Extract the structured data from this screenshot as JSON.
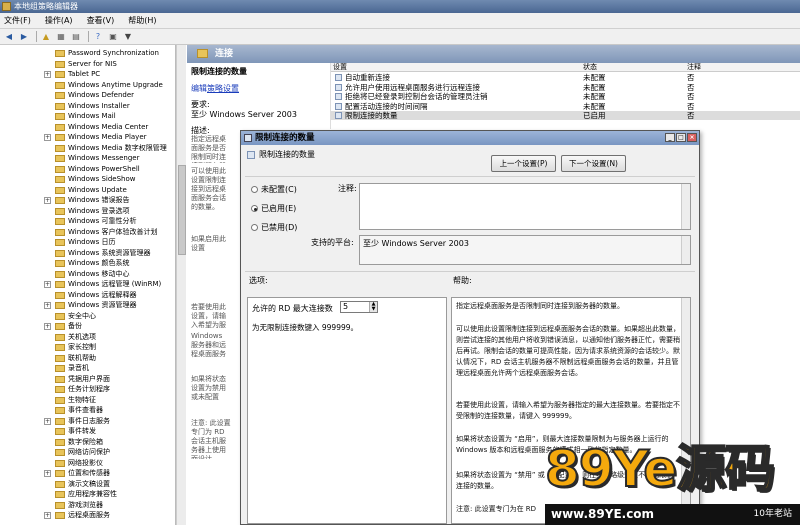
{
  "window": {
    "title": "本地组策略编辑器",
    "icon": "policy-editor-icon"
  },
  "menu": [
    "文件(F)",
    "操作(A)",
    "查看(V)",
    "帮助(H)"
  ],
  "toolbar": {
    "icons": [
      "back-icon",
      "forward-icon",
      "up-icon",
      "show-hide-tree-icon",
      "export-icon",
      "help-icon",
      "properties-icon",
      "filter-icon"
    ]
  },
  "tree": {
    "items": [
      {
        "label": "Password Synchronization",
        "expandable": false
      },
      {
        "label": "Server for NIS",
        "expandable": false
      },
      {
        "label": "Tablet PC",
        "expandable": true
      },
      {
        "label": "Windows Anytime Upgrade",
        "expandable": false
      },
      {
        "label": "Windows Defender",
        "expandable": false
      },
      {
        "label": "Windows Installer",
        "expandable": false
      },
      {
        "label": "Windows Mail",
        "expandable": false
      },
      {
        "label": "Windows Media Center",
        "expandable": false
      },
      {
        "label": "Windows Media Player",
        "expandable": true
      },
      {
        "label": "Windows Media 数字权限管理",
        "expandable": false
      },
      {
        "label": "Windows Messenger",
        "expandable": false
      },
      {
        "label": "Windows PowerShell",
        "expandable": false
      },
      {
        "label": "Windows SideShow",
        "expandable": false
      },
      {
        "label": "Windows Update",
        "expandable": false
      },
      {
        "label": "Windows 错误报告",
        "expandable": true
      },
      {
        "label": "Windows 登录选项",
        "expandable": false
      },
      {
        "label": "Windows 可靠性分析",
        "expandable": false
      },
      {
        "label": "Windows 客户体验改善计划",
        "expandable": false
      },
      {
        "label": "Windows 日历",
        "expandable": false
      },
      {
        "label": "Windows 系统资源管理器",
        "expandable": false
      },
      {
        "label": "Windows 颜色系统",
        "expandable": false
      },
      {
        "label": "Windows 移动中心",
        "expandable": false
      },
      {
        "label": "Windows 远程管理 (WinRM)",
        "expandable": true
      },
      {
        "label": "Windows 远程解释器",
        "expandable": false
      },
      {
        "label": "Windows 资源管理器",
        "expandable": true
      },
      {
        "label": "安全中心",
        "expandable": false
      },
      {
        "label": "备份",
        "expandable": true
      },
      {
        "label": "关机选项",
        "expandable": false
      },
      {
        "label": "家长控制",
        "expandable": false
      },
      {
        "label": "联机帮助",
        "expandable": false
      },
      {
        "label": "录音机",
        "expandable": false
      },
      {
        "label": "凭据用户界面",
        "expandable": false
      },
      {
        "label": "任务计划程序",
        "expandable": false
      },
      {
        "label": "生物特征",
        "expandable": false
      },
      {
        "label": "事件查看器",
        "expandable": false
      },
      {
        "label": "事件日志服务",
        "expandable": true
      },
      {
        "label": "事件转发",
        "expandable": false
      },
      {
        "label": "数字保险箱",
        "expandable": false
      },
      {
        "label": "网络访问保护",
        "expandable": false
      },
      {
        "label": "网络投影仪",
        "expandable": false
      },
      {
        "label": "位置和传感器",
        "expandable": true
      },
      {
        "label": "演示文稿设置",
        "expandable": false
      },
      {
        "label": "应用程序兼容性",
        "expandable": false
      },
      {
        "label": "游戏浏览器",
        "expandable": false
      },
      {
        "label": "远程桌面服务",
        "expandable": true
      }
    ]
  },
  "content": {
    "header": "连接"
  },
  "description": {
    "title": "限制连接的数量",
    "edit_prefix": "编辑",
    "edit_link": "策略设置",
    "requirements_label": "要求:",
    "requirements_value": "至少 Windows Server 2003",
    "description_label": "描述:",
    "fragments": [
      "指定远程桌面服务是否限制同时连接到服务器的数量。",
      "可以使用此设置限制连接到远程桌面服务会话的数量。",
      "如果启用此设置",
      "若要使用此设置，请输入希望为服务器指定的最大连接数量。",
      "Windows 服务器和远程桌面服务相一致的指定数量。",
      "如果将状态设置为禁用或未配置",
      "注意: 此设置专门为 RD 会话主机服务器上使用而设计。"
    ]
  },
  "list": {
    "columns": {
      "setting": "设置",
      "state": "状态",
      "comment": "注释"
    },
    "rows": [
      {
        "name": "自动重新连接",
        "state": "未配置",
        "comment": "否"
      },
      {
        "name": "允许用户使用远程桌面服务进行远程连接",
        "state": "未配置",
        "comment": "否"
      },
      {
        "name": "拒绝将已经登录到控制台会话的管理员注销",
        "state": "未配置",
        "comment": "否"
      },
      {
        "name": "配置活动连接的时间间隔",
        "state": "未配置",
        "comment": "否"
      },
      {
        "name": "限制连接的数量",
        "state": "已启用",
        "comment": "否"
      }
    ]
  },
  "dialog": {
    "title": "限制连接的数量",
    "heading": "限制连接的数量",
    "prev_button": "上一个设置(P)",
    "next_button": "下一个设置(N)",
    "radio": {
      "not_configured": "未配置(C)",
      "enabled": "已启用(E)",
      "disabled": "已禁用(D)",
      "selected": "enabled"
    },
    "comment_label": "注释:",
    "comment_value": "",
    "supported_label": "支持的平台:",
    "supported_value": "至少 Windows Server 2003",
    "options_label": "选项:",
    "help_label": "帮助:",
    "option_field_label": "允许的 RD 最大连接数",
    "option_field_value": "5",
    "option_note": "为无限制连接数键入 999999。",
    "help_paragraphs": [
      "指定远程桌面服务是否限制同时连接到服务器的数量。",
      "可以使用此设置限制连接到远程桌面服务会话的数量。如果超出此数量，则尝试连接的其他用户将收到错误消息，以通知他们服务器正忙，需要稍后再试。限制会话的数量可提高性能，因为请求系统资源的会话较少。默认情况下，RD 会话主机服务器不限制远程桌面服务会话的数量，并且管理远程桌面允许两个远程桌面服务会话。",
      "若要使用此设置，请输入希望为服务器指定的最大连接数量。若要指定不受限制的连接数量，请键入 999999。",
      "如果将状态设置为 “启用”，则最大连接数量限制为与服务器上运行的 Windows 版本和远程桌面服务的模式相一致的指定数量。",
      "如果将状态设置为 “禁用” 或 “未配置”，则在组策略级别上不强制限制连接的数量。",
      "注意: 此设置专门为在 RD"
    ]
  },
  "watermark": {
    "brand": "89Ye源码",
    "url": "www.89YE.com",
    "tag": "10年老站"
  }
}
